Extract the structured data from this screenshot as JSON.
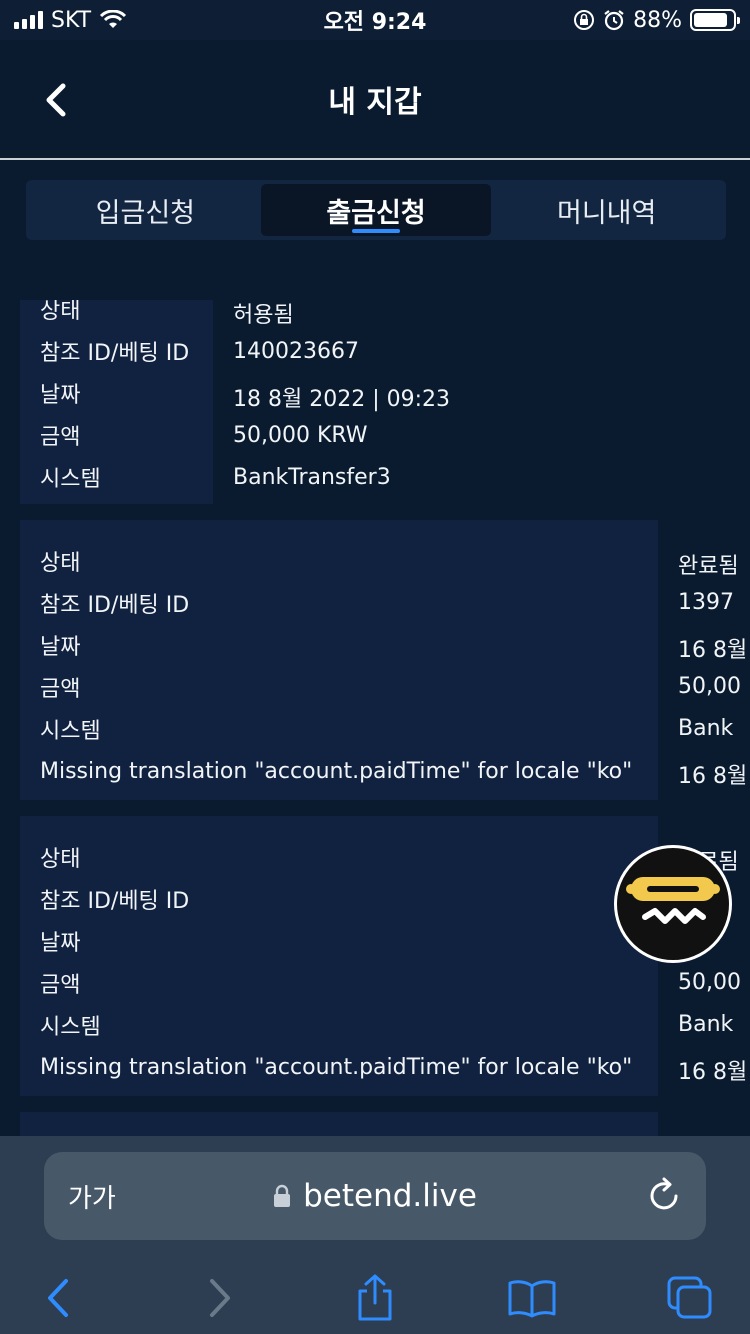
{
  "status_bar": {
    "carrier": "SKT",
    "time": "오전 9:24",
    "battery_percent": "88%",
    "battery_level": 0.88
  },
  "header": {
    "title": "내 지갑"
  },
  "tabs": [
    {
      "label": "입금신청",
      "active": false
    },
    {
      "label": "출금신청",
      "active": true
    },
    {
      "label": "머니내역",
      "active": false
    }
  ],
  "records": [
    {
      "rows": [
        {
          "label": "상태",
          "value": "허용됨"
        },
        {
          "label": "참조 ID/베팅 ID",
          "value": "140023667"
        },
        {
          "label": "날짜",
          "value": "18 8월 2022 | 09:23"
        },
        {
          "label": "금액",
          "value": "50,000 KRW"
        },
        {
          "label": "시스템",
          "value": "BankTransfer3"
        }
      ]
    },
    {
      "rows": [
        {
          "label": "상태",
          "value": "완료됨"
        },
        {
          "label": "참조 ID/베팅 ID",
          "value": "1397"
        },
        {
          "label": "날짜",
          "value": "16 8월"
        },
        {
          "label": "금액",
          "value": "50,00"
        },
        {
          "label": "시스템",
          "value": "Bank"
        },
        {
          "label": "Missing translation \"account.paidTime\" for locale \"ko\"",
          "value": "16 8월"
        }
      ]
    },
    {
      "rows": [
        {
          "label": "상태",
          "value": "완료됨"
        },
        {
          "label": "참조 ID/베팅 ID",
          "value": ""
        },
        {
          "label": "날짜",
          "value": "8"
        },
        {
          "label": "금액",
          "value": "50,00"
        },
        {
          "label": "시스템",
          "value": "Bank"
        },
        {
          "label": "Missing translation \"account.paidTime\" for locale \"ko\"",
          "value": "16 8월"
        }
      ]
    }
  ],
  "browser": {
    "text_size_label": "가가",
    "url": "betend.live"
  },
  "colors": {
    "background": "#0b1b2f",
    "card": "#112240",
    "accent": "#2f8cff",
    "logo_yellow": "#f2c94c"
  },
  "icons": {
    "back": "chevron-left-icon",
    "lock": "lock-icon",
    "reload": "reload-icon",
    "share": "share-icon",
    "bookmarks": "book-icon",
    "tabs": "tabs-icon",
    "logo": "hotdog-logo-icon"
  }
}
